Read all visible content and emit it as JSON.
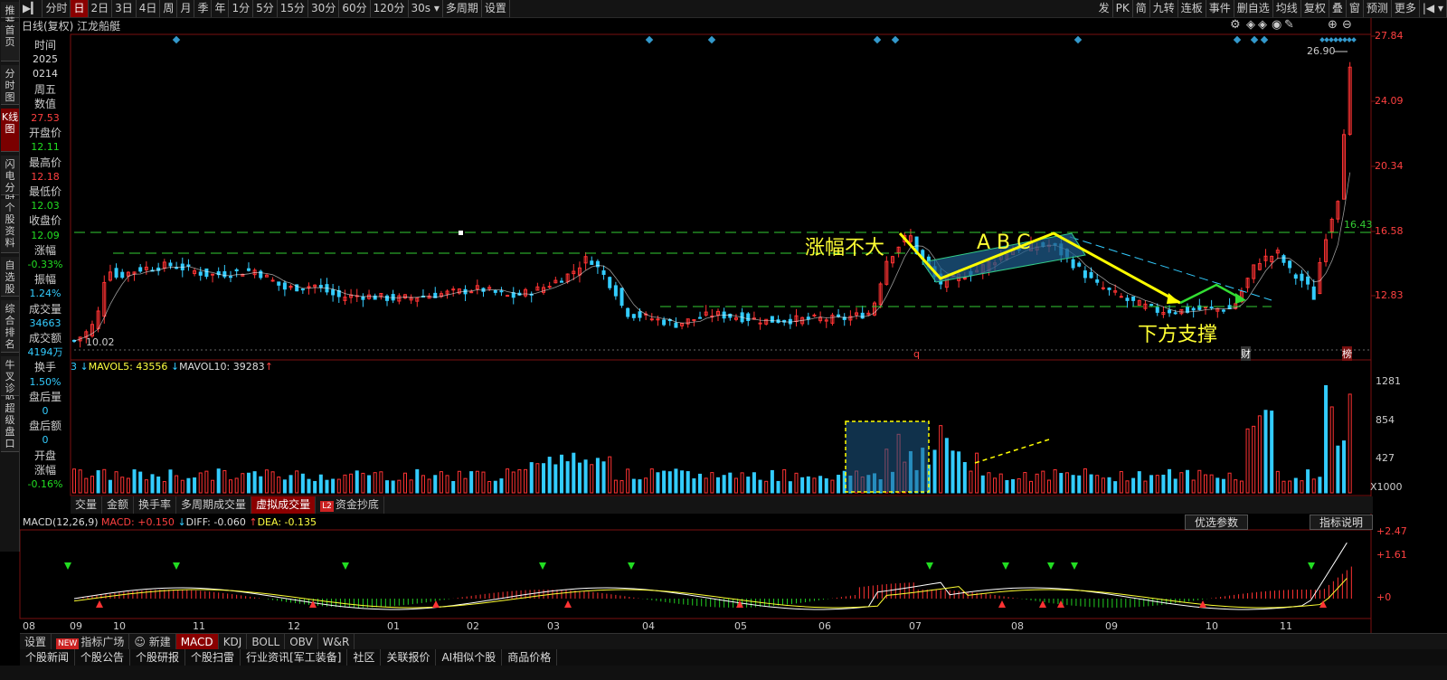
{
  "sidebar": {
    "items": [
      "推荐",
      "首页",
      "分时图",
      "K线图",
      "闪电分时",
      "个股资料",
      "自选股",
      "综合排名",
      "牛叉诊股",
      "超级盘口"
    ],
    "active": 3
  },
  "toolbar": {
    "items": [
      "分时",
      "日",
      "2日",
      "3日",
      "4日",
      "周",
      "月",
      "季",
      "年",
      "1分",
      "5分",
      "15分",
      "30分",
      "60分",
      "120分",
      "30s",
      "多周期",
      "设置"
    ],
    "active": 1,
    "right_items": [
      "发",
      "PK",
      "简",
      "九转",
      "连板",
      "事件",
      "删自选",
      "均线",
      "复权",
      "叠",
      "窗",
      "预测",
      "更多"
    ]
  },
  "info": {
    "title": "日线(复权)  江龙船艇"
  },
  "datapanel": [
    {
      "label": "时间",
      "value": "2025",
      "cls": "white"
    },
    {
      "label": "",
      "value": "0214",
      "cls": "white"
    },
    {
      "label": "周五",
      "value": "",
      "cls": "white"
    },
    {
      "label": "数值",
      "value": "27.53",
      "cls": "red"
    },
    {
      "label": "开盘价",
      "value": "12.11",
      "cls": "green"
    },
    {
      "label": "最高价",
      "value": "12.18",
      "cls": "red"
    },
    {
      "label": "最低价",
      "value": "12.03",
      "cls": "green"
    },
    {
      "label": "收盘价",
      "value": "12.09",
      "cls": "green"
    },
    {
      "label": "涨幅",
      "value": "-0.33%",
      "cls": "green"
    },
    {
      "label": "振幅",
      "value": "1.24%",
      "cls": "cyan"
    },
    {
      "label": "成交量",
      "value": "34663",
      "cls": "cyan"
    },
    {
      "label": "成交额",
      "value": "4194万",
      "cls": "cyan"
    },
    {
      "label": "换手",
      "value": "1.50%",
      "cls": "cyan"
    },
    {
      "label": "盘后量",
      "value": "0",
      "cls": "cyan"
    },
    {
      "label": "盘后额",
      "value": "0",
      "cls": "cyan"
    },
    {
      "label": "开盘",
      "value": "",
      "cls": "white"
    },
    {
      "label": "涨幅",
      "value": "-0.16%",
      "cls": "green"
    }
  ],
  "price_axis": {
    "labels": [
      "27.84",
      "24.09",
      "20.34",
      "16.58",
      "12.83"
    ],
    "hline_value": "16.43",
    "high_label": "26.90",
    "low_label": "10.02"
  },
  "annotations": {
    "a1": "涨幅不大",
    "a2": "A  B  C",
    "a3": "下方支撑"
  },
  "markers": {
    "q": "q",
    "cai": "财",
    "bang": "榜"
  },
  "volume": {
    "mavol5_label": "MAVOL5: 43556",
    "mavol10_label": "MAVOL10: 39283",
    "axis": [
      "1281",
      "854",
      "427"
    ],
    "unit": "X1000"
  },
  "vol_tabs": [
    "交量",
    "金额",
    "换手率",
    "多周期成交量",
    "虚拟成交量",
    "资金抄底"
  ],
  "vol_tab_active": 4,
  "vol_tab_badge": "L2",
  "macd": {
    "title": "MACD(12,26,9)",
    "macd": "MACD: +0.150",
    "diff": "DIFF: -0.060",
    "dea": "DEA: -0.135",
    "axis": [
      "+2.47",
      "+1.61",
      "+0"
    ],
    "btn1": "优选参数",
    "btn2": "指标说明"
  },
  "months": [
    "08",
    "09",
    "10",
    "11",
    "12",
    "01",
    "02",
    "03",
    "04",
    "05",
    "06",
    "07",
    "08",
    "09",
    "10",
    "11"
  ],
  "bottom_tabs": [
    "设置",
    "指标广场",
    "新建",
    "MACD",
    "KDJ",
    "BOLL",
    "OBV",
    "W&R"
  ],
  "bottom_new_badge": "NEW",
  "bottom_active": 3,
  "news": [
    "个股新闻",
    "个股公告",
    "个股研报",
    "个股扫雷",
    "行业资讯[军工装备]",
    "社区",
    "关联报价",
    "AI相似个股",
    "商品价格"
  ],
  "colors": {
    "up": "#ff3333",
    "down": "#33ccff",
    "ma": "#ffff33",
    "dash": "#33cc33",
    "arrow": "#ffff00",
    "box": "#1e5a88"
  }
}
